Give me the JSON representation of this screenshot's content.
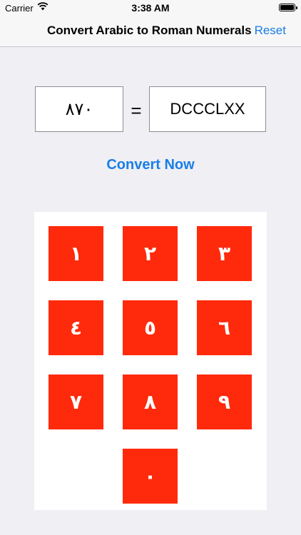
{
  "status_bar": {
    "carrier": "Carrier",
    "time": "3:38 AM"
  },
  "nav": {
    "title": "Convert Arabic to Roman Numerals",
    "reset_label": "Reset"
  },
  "converter": {
    "arabic_value": "٨٧٠",
    "equals": "=",
    "roman_value": "DCCCLXX",
    "convert_label": "Convert Now"
  },
  "keypad": {
    "keys": [
      "١",
      "٢",
      "٣",
      "٤",
      "٥",
      "٦",
      "٧",
      "٨",
      "٩",
      "٠"
    ]
  },
  "colors": {
    "accent": "#1a7ee6",
    "key_background": "#ff2a0c",
    "background": "#efeff4"
  }
}
